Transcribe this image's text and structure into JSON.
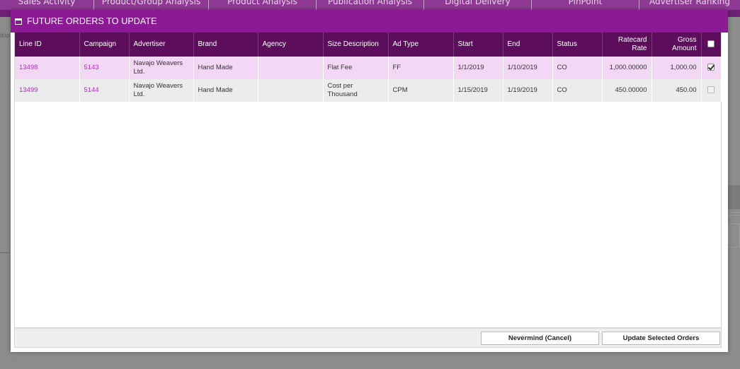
{
  "background_nav": {
    "tabs": [
      "Sales Activity",
      "Product/Group Analysis",
      "Product Analysis",
      "Publication Analysis",
      "Digital Delivery",
      "PinPoint",
      "Advertiser Ranking"
    ],
    "left_fragment": "itio"
  },
  "modal": {
    "title": "FUTURE ORDERS TO UPDATE",
    "columns": {
      "line_id": "Line ID",
      "campaign": "Campaign",
      "advertiser": "Advertiser",
      "brand": "Brand",
      "agency": "Agency",
      "size_description": "Size Description",
      "ad_type": "Ad Type",
      "start": "Start",
      "end": "End",
      "status": "Status",
      "ratecard_rate": "Ratecard Rate",
      "gross_amount": "Gross Amount"
    },
    "rows": [
      {
        "line_id": "13498",
        "campaign": "5143",
        "advertiser": "Navajo Weavers Ltd.",
        "brand": "Hand Made",
        "agency": "",
        "size_description": "Flat Fee",
        "ad_type": "FF",
        "start": "1/1/2019",
        "end": "1/10/2019",
        "status": "CO",
        "ratecard_rate": "1,000.00000",
        "gross_amount": "1,000.00",
        "selected": true
      },
      {
        "line_id": "13499",
        "campaign": "5144",
        "advertiser": "Navajo Weavers Ltd.",
        "brand": "Hand Made",
        "agency": "",
        "size_description": "Cost per Thousand",
        "ad_type": "CPM",
        "start": "1/15/2019",
        "end": "1/19/2019",
        "status": "CO",
        "ratecard_rate": "450.00000",
        "gross_amount": "450.00",
        "selected": false
      }
    ],
    "buttons": {
      "cancel": "Nevermind (Cancel)",
      "update": "Update Selected Orders"
    }
  },
  "colors": {
    "header_purple": "#8b1a94",
    "column_header": "#5c0e5c",
    "selected_row": "#f2d8f4",
    "link": "#b52cc0"
  }
}
